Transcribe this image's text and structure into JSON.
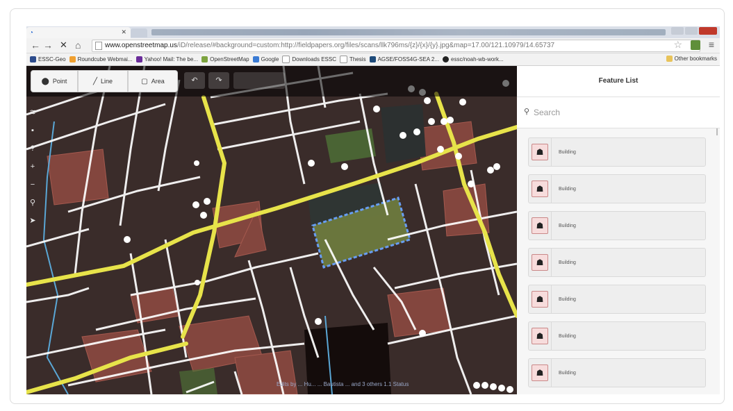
{
  "browser": {
    "tab": {
      "title": "",
      "icon": "loading-icon"
    },
    "nav": {
      "back": "←",
      "forward": "→",
      "reload": "✕",
      "home": "⌂"
    },
    "address": {
      "host": "www.openstreetmap.us",
      "path": "/iD/release/#background=custom:http://fieldpapers.org/files/scans/llk796ms/{z}/{x}/{y}.jpg&map=17.00/121.10979/14.65737"
    },
    "bookmarks": [
      {
        "label": "ESSC-Geo",
        "icon_color": "#2d4c8c"
      },
      {
        "label": "Roundcube Webmai...",
        "icon_color": "#f0a030"
      },
      {
        "label": "Yahoo! Mail: The be...",
        "icon_color": "#6a2c9a"
      },
      {
        "label": "OpenStreetMap",
        "icon_color": "#7da33f"
      },
      {
        "label": "Google",
        "icon_color": "#3b7bd4"
      },
      {
        "label": "Downloads ESSC",
        "icon_color": "#ffffff"
      },
      {
        "label": "Thesis",
        "icon_color": "#ffffff"
      },
      {
        "label": "AGSE/FOSS4G-SEA 2...",
        "icon_color": "#1e4b7a"
      },
      {
        "label": "essc/noah-wb-work...",
        "icon_color": "#222222"
      }
    ],
    "other_bookmarks": "Other bookmarks"
  },
  "editor": {
    "modes": {
      "point": "Point",
      "line": "Line",
      "area": "Area"
    },
    "attribution": "Edits by ... Hu... ... Bautista ... and 3 others   1.1 Status"
  },
  "sidebar": {
    "title": "Feature List",
    "search_placeholder": "Search",
    "items": [
      {
        "label": "Building"
      },
      {
        "label": "Building"
      },
      {
        "label": "Building"
      },
      {
        "label": "Building"
      },
      {
        "label": "Building"
      },
      {
        "label": "Building"
      },
      {
        "label": "Building"
      }
    ]
  },
  "colors": {
    "map_background": "#3a2c2a",
    "major_road": "#e7e34a",
    "minor_road": "#ffffff",
    "building_fill": "#b65a4e",
    "park_fill": "#4d6e36",
    "selection": "#6ba4ff",
    "waterway": "#5aa7d6"
  }
}
